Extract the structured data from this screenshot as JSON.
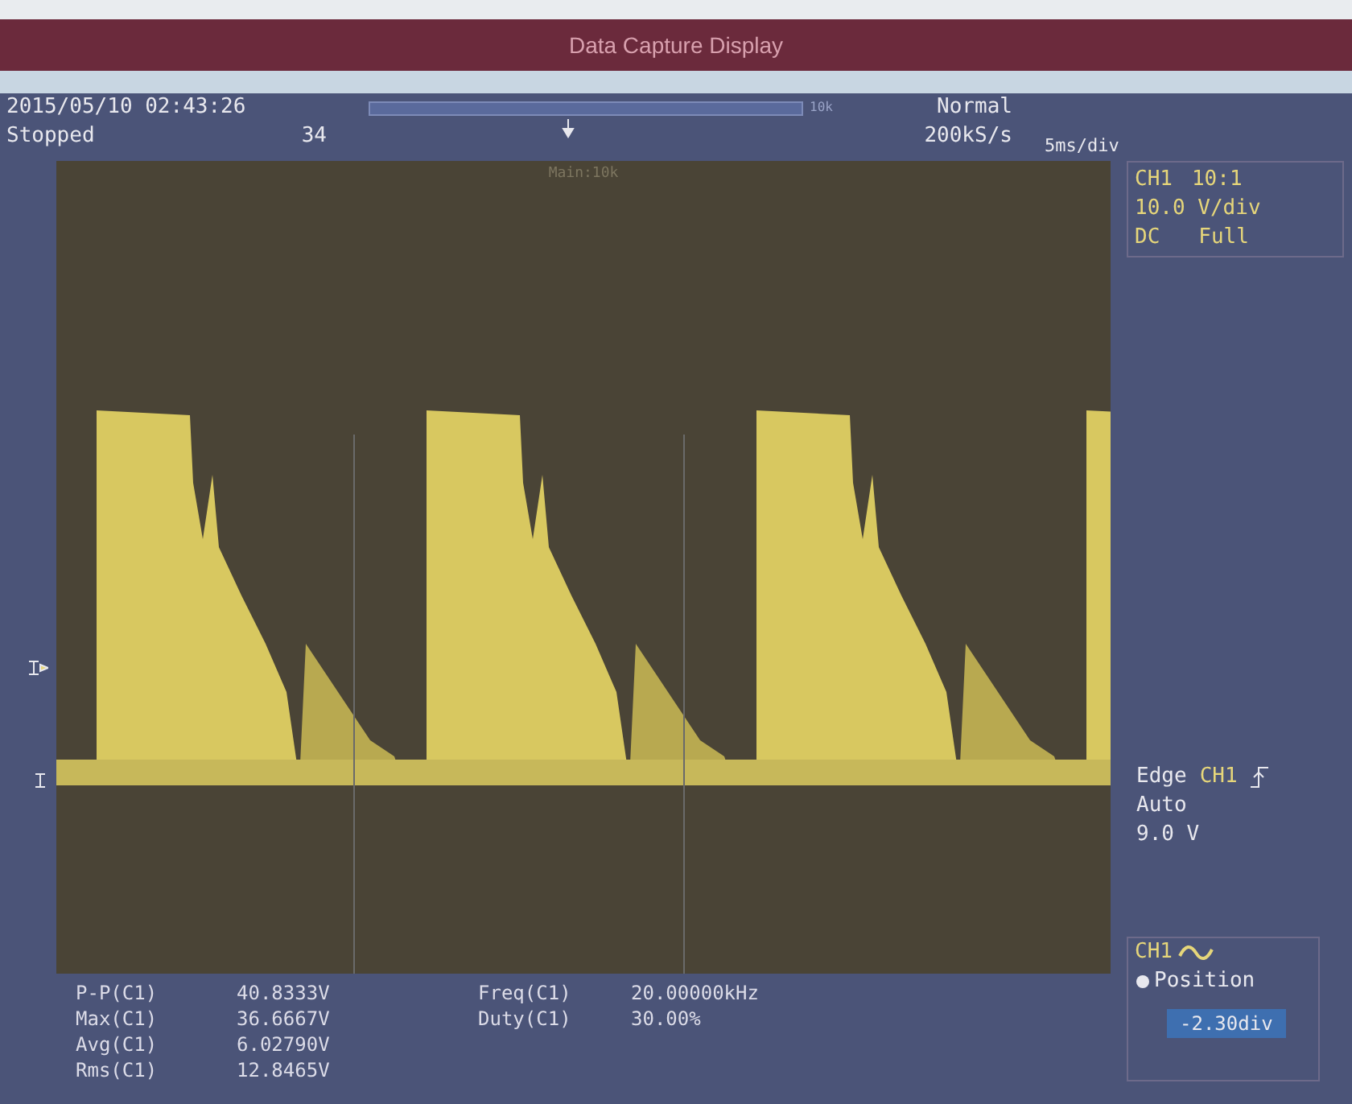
{
  "window": {
    "title": "Data Capture Display"
  },
  "status": {
    "datetime": "2015/05/10 02:43:26",
    "state": "Stopped",
    "count": "34",
    "memory": "10k",
    "mode": "Normal",
    "sample_rate": "200kS/s",
    "timebase": "5ms/div"
  },
  "plot": {
    "label": "Main:10k"
  },
  "channel": {
    "name": "CH1",
    "probe": "10:1",
    "scale": "10.0 V/div",
    "coupling": "DC",
    "bandwidth": "Full"
  },
  "trigger": {
    "type": "Edge",
    "source": "CH1",
    "mode": "Auto",
    "level": "9.0 V"
  },
  "position": {
    "channel": "CH1",
    "label": "Position",
    "value": "-2.30div"
  },
  "measurements": {
    "amplitude": [
      {
        "label": "P-P(C1)",
        "value": "40.8333V"
      },
      {
        "label": "Max(C1)",
        "value": "36.6667V"
      },
      {
        "label": "Avg(C1)",
        "value": "6.02790V"
      },
      {
        "label": "Rms(C1)",
        "value": "12.8465V"
      }
    ],
    "timing": [
      {
        "label": "Freq(C1)",
        "value": "20.00000kHz"
      },
      {
        "label": "Duty(C1)",
        "value": "30.00%"
      }
    ]
  }
}
